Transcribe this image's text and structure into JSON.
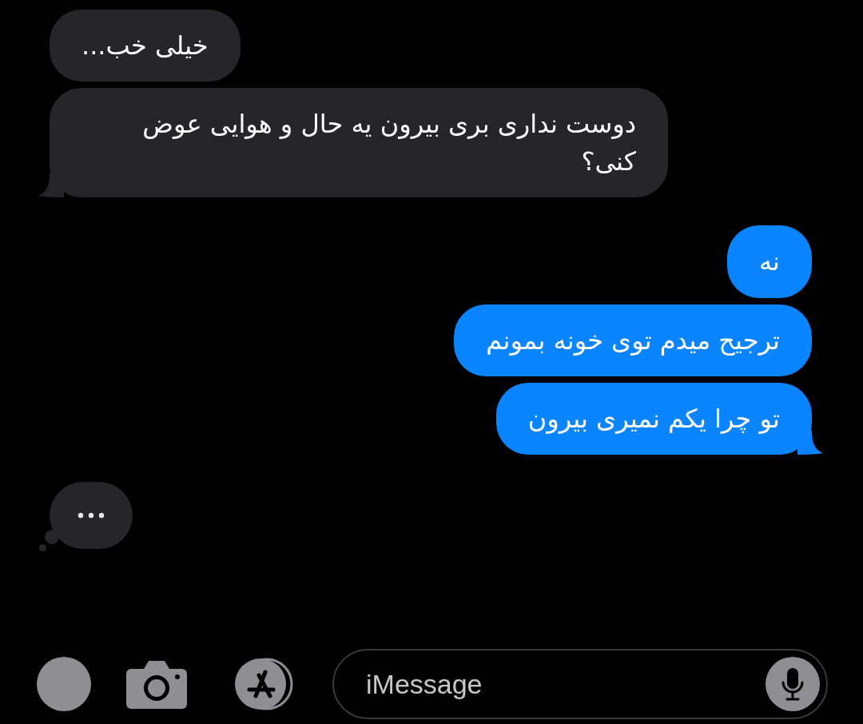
{
  "messages": [
    {
      "kind": "received",
      "text": "خیلی خب...",
      "tail": false
    },
    {
      "kind": "received",
      "text": "دوست نداری بری بیرون یه حال و هوایی عوض کنی؟",
      "tail": true
    },
    {
      "kind": "sent",
      "text": "نه",
      "tail": false
    },
    {
      "kind": "sent",
      "text": "ترجیح میدم توی خونه بمونم",
      "tail": false
    },
    {
      "kind": "sent",
      "text": "تو چرا یکم نمیری بیرون",
      "tail": true
    }
  ],
  "typing_indicator": true,
  "composer": {
    "placeholder": "iMessage"
  }
}
